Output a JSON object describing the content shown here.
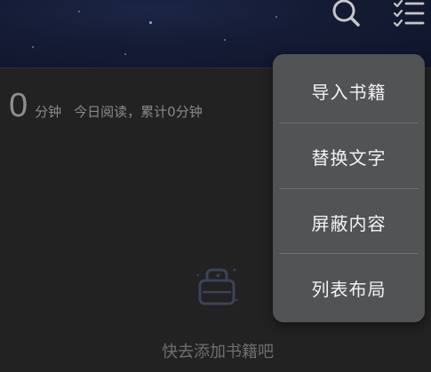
{
  "header": {
    "search_icon": "search-icon",
    "menu_icon": "checklist-icon"
  },
  "stats": {
    "minutes": "0",
    "unit": "分钟",
    "today_text": "今日阅读，累计0分钟"
  },
  "empty_state": {
    "icon": "book-box-icon",
    "text": "快去添加书籍吧"
  },
  "popup_menu": {
    "items": [
      {
        "label": "导入书籍"
      },
      {
        "label": "替换文字"
      },
      {
        "label": "屏蔽内容"
      },
      {
        "label": "列表布局"
      }
    ]
  },
  "colors": {
    "background": "#222222",
    "header_bg": "#141b34",
    "menu_bg": "#525355",
    "menu_text": "#f2f2f2",
    "muted_text": "#8a8a8a",
    "icon_color": "#c6c6c6"
  }
}
